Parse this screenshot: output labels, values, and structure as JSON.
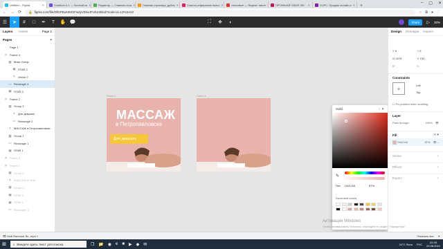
{
  "browser": {
    "tabs": [
      {
        "label": "Untitled – Figma",
        "color": "#1abcfe",
        "active": true
      },
      {
        "label": "Cosblum 4.1 — Личный ка",
        "color": "#6c4fd1",
        "active": false
      },
      {
        "label": "Редактор — Главная стра",
        "color": "#4caf50",
        "active": false
      },
      {
        "label": "Главная страница_дубль",
        "color": "#ff9800",
        "active": false
      },
      {
        "label": "Список рефералов польз",
        "color": "#e91e63",
        "active": false
      },
      {
        "label": "тепловые — Яндекс: нашл",
        "color": "#e53935",
        "active": false
      },
      {
        "label": "ПРОКАЧАЙ СВОЙ ЛЮ",
        "color": "#c2185b",
        "active": false
      },
      {
        "label": "ХОРС. Продаж онлайн-к",
        "color": "#7b1fa2",
        "active": false
      }
    ],
    "url": "figma.com/file/DfGPEwHtMXFwdyVIDwJFU/Untitled?node-id=13%3A22"
  },
  "toolbar": {
    "share_label": "Share",
    "zoom": "30%"
  },
  "left_panel": {
    "tabs": {
      "layers": "Layers",
      "assets": "Assets",
      "page": "Page 1"
    },
    "pages_heading": "Pages",
    "layers": [
      {
        "label": "Page 1",
        "indent": 1,
        "icon": "page-icon",
        "state": ""
      },
      {
        "label": "Frame 4",
        "indent": 1,
        "icon": "frame-icon",
        "state": ""
      },
      {
        "label": "Mask Group",
        "indent": 2,
        "icon": "group-icon",
        "state": ""
      },
      {
        "label": "STAR 2",
        "indent": 3,
        "icon": "image-icon",
        "state": ""
      },
      {
        "label": "Vector 2",
        "indent": 3,
        "icon": "vector-icon",
        "state": ""
      },
      {
        "label": "Rectangle 4",
        "indent": 2,
        "icon": "rect-icon",
        "state": "sel"
      },
      {
        "label": "STAR 3",
        "indent": 2,
        "icon": "image-icon",
        "state": ""
      },
      {
        "label": "Frame 2",
        "indent": 1,
        "icon": "frame-icon",
        "state": ""
      },
      {
        "label": "Group 3",
        "indent": 2,
        "icon": "group-icon",
        "state": ""
      },
      {
        "label": "Для девушек",
        "indent": 3,
        "icon": "text-icon",
        "state": ""
      },
      {
        "label": "Rectangle 2",
        "indent": 3,
        "icon": "rect-icon",
        "state": ""
      },
      {
        "label": "МАССАЖ в Петропавловске",
        "indent": 2,
        "icon": "text-icon",
        "state": ""
      },
      {
        "label": "Group 1",
        "indent": 2,
        "icon": "group-icon",
        "state": ""
      },
      {
        "label": "Rectangle 1",
        "indent": 2,
        "icon": "rect-icon",
        "state": ""
      },
      {
        "label": "STAR 1",
        "indent": 2,
        "icon": "image-icon",
        "state": ""
      },
      {
        "label": "Frame 3",
        "indent": 1,
        "icon": "frame-icon",
        "state": "dim"
      },
      {
        "label": "Frame 2",
        "indent": 1,
        "icon": "frame-icon",
        "state": "dim"
      },
      {
        "label": "Group 2",
        "indent": 2,
        "icon": "group-icon",
        "state": "dim"
      },
      {
        "label": "МАССАЖ в Петр",
        "indent": 2,
        "icon": "text-icon",
        "state": "dim"
      },
      {
        "label": "Group 1",
        "indent": 2,
        "icon": "group-icon",
        "state": "dim"
      },
      {
        "label": "STAR 2",
        "indent": 2,
        "icon": "image-icon",
        "state": "dim"
      },
      {
        "label": "STAR 1",
        "indent": 2,
        "icon": "image-icon",
        "state": "dim"
      },
      {
        "label": "Rectangle 1",
        "indent": 2,
        "icon": "rect-icon",
        "state": "dim"
      }
    ]
  },
  "canvas": {
    "frame1_label": "Frame 2",
    "frame2_label": "Frame 4",
    "title": "МАССАЖ",
    "subtitle": "в Петропавловске",
    "button": "Для девушек",
    "bg_color": "#e9b3ad",
    "accent": "#f6c737"
  },
  "right_panel": {
    "tabs": {
      "design": "Design",
      "prototype": "Prototype",
      "inspect": "Inspect"
    },
    "x": "0",
    "y": "0",
    "w": "1176",
    "h": "741",
    "rotation": "0°",
    "radius": "0",
    "constraints": "Constraints",
    "c_left": "Left",
    "c_top": "Top",
    "fix_scroll": "Fix position when scrolling",
    "layer_heading": "Layer",
    "pass_through": "Pass through",
    "layer_opacity": "100%",
    "fill_heading": "Fill",
    "fill_hex": "D9A7A6",
    "fill_opacity": "87%",
    "stroke": "Stroke",
    "effects": "Effects",
    "export": "Export"
  },
  "picker": {
    "title": "Solid",
    "hex_label": "Hex",
    "hex": "D9A7A6",
    "opacity": "87%",
    "doc_colors_label": "Document colors",
    "swatches": [
      "#ffffff",
      "#ececec",
      "#cfcfcf",
      "#222222",
      "#4a4a4a",
      "#f6c737",
      "#f0d35a",
      "#e5e5e5",
      "#111111",
      "#fafafa",
      "#d9a7a6",
      "#e8b6a6",
      "#c98b7c",
      "#a36a5d",
      "#7a4a3d",
      "#f2c9bc"
    ]
  },
  "watermark": {
    "line1": "Активация Windows",
    "line2": "Чтобы активировать Windows, перейдите в раздел \"Параметры\"."
  },
  "download": {
    "file": "Мой Ramount №...mp4",
    "show_all": "Показать все"
  },
  "taskbar": {
    "search": "Введите здесь текст для поиска",
    "weather": "24°C Ясно",
    "lang": "РУС",
    "time": "22:45",
    "date": "20.08.2021"
  }
}
